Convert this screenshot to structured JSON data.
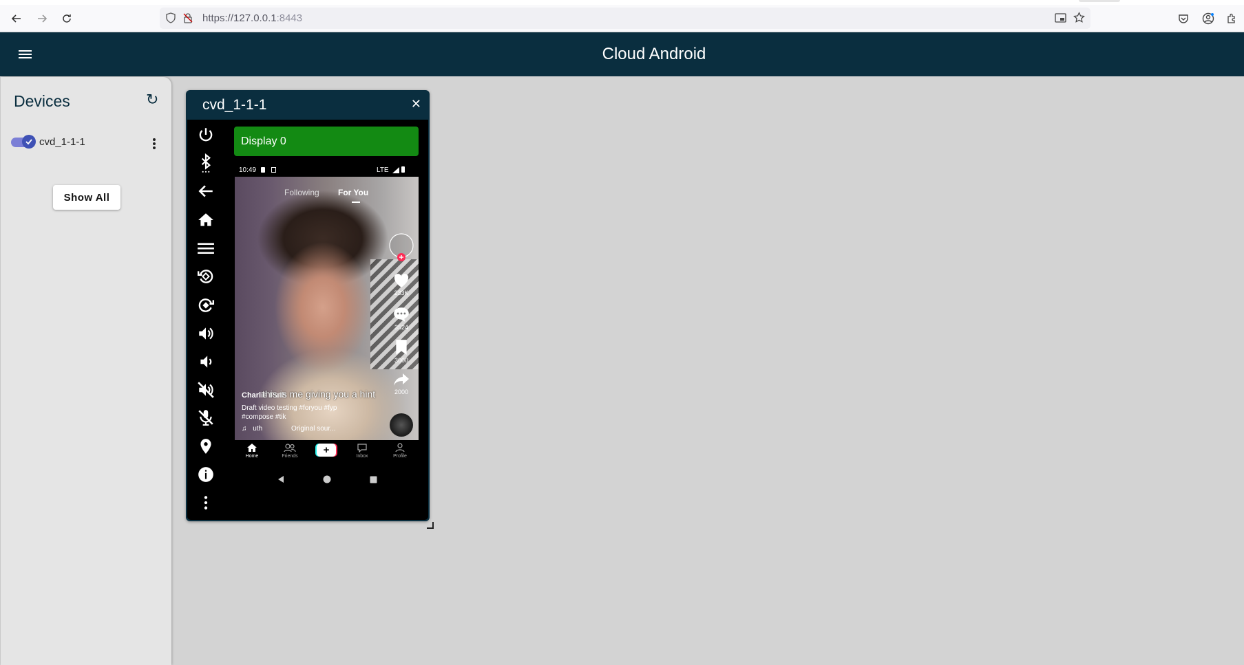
{
  "browser": {
    "url_host": "https://127.0.0.1",
    "url_port": ":8443"
  },
  "app": {
    "title": "Cloud Android"
  },
  "sidebar": {
    "title": "Devices",
    "refresh_icon": "↻",
    "devices": [
      {
        "name": "cvd_1-1-1",
        "enabled": true
      }
    ],
    "show_all_label": "Show All"
  },
  "panel": {
    "title": "cvd_1-1-1",
    "close_label": "✕",
    "display_label": "Display 0",
    "controls": [
      "power-icon",
      "bluetooth-icon",
      "back-icon",
      "home-icon",
      "menu-icon",
      "rotate-left-icon",
      "rotate-right-icon",
      "volume-up-icon",
      "volume-down-icon",
      "volume-mute-icon",
      "mic-off-icon",
      "location-icon",
      "info-icon",
      "more-icon"
    ]
  },
  "phone": {
    "time": "10:49",
    "network": "LTE",
    "tabs": {
      "following": "Following",
      "for_you": "For You"
    },
    "likes": "233K",
    "comments": "3524",
    "saves": "3000",
    "shares": "2000",
    "caption_overlay": "this is me giving you a hint",
    "author": "Charlie Puth",
    "description": "Draft video testing  #foryou #fyp #compose #tik",
    "sound_left": "uth",
    "sound_right": "Original sour...",
    "nav": [
      "Home",
      "Friends",
      "Inbox",
      "Profile"
    ]
  }
}
